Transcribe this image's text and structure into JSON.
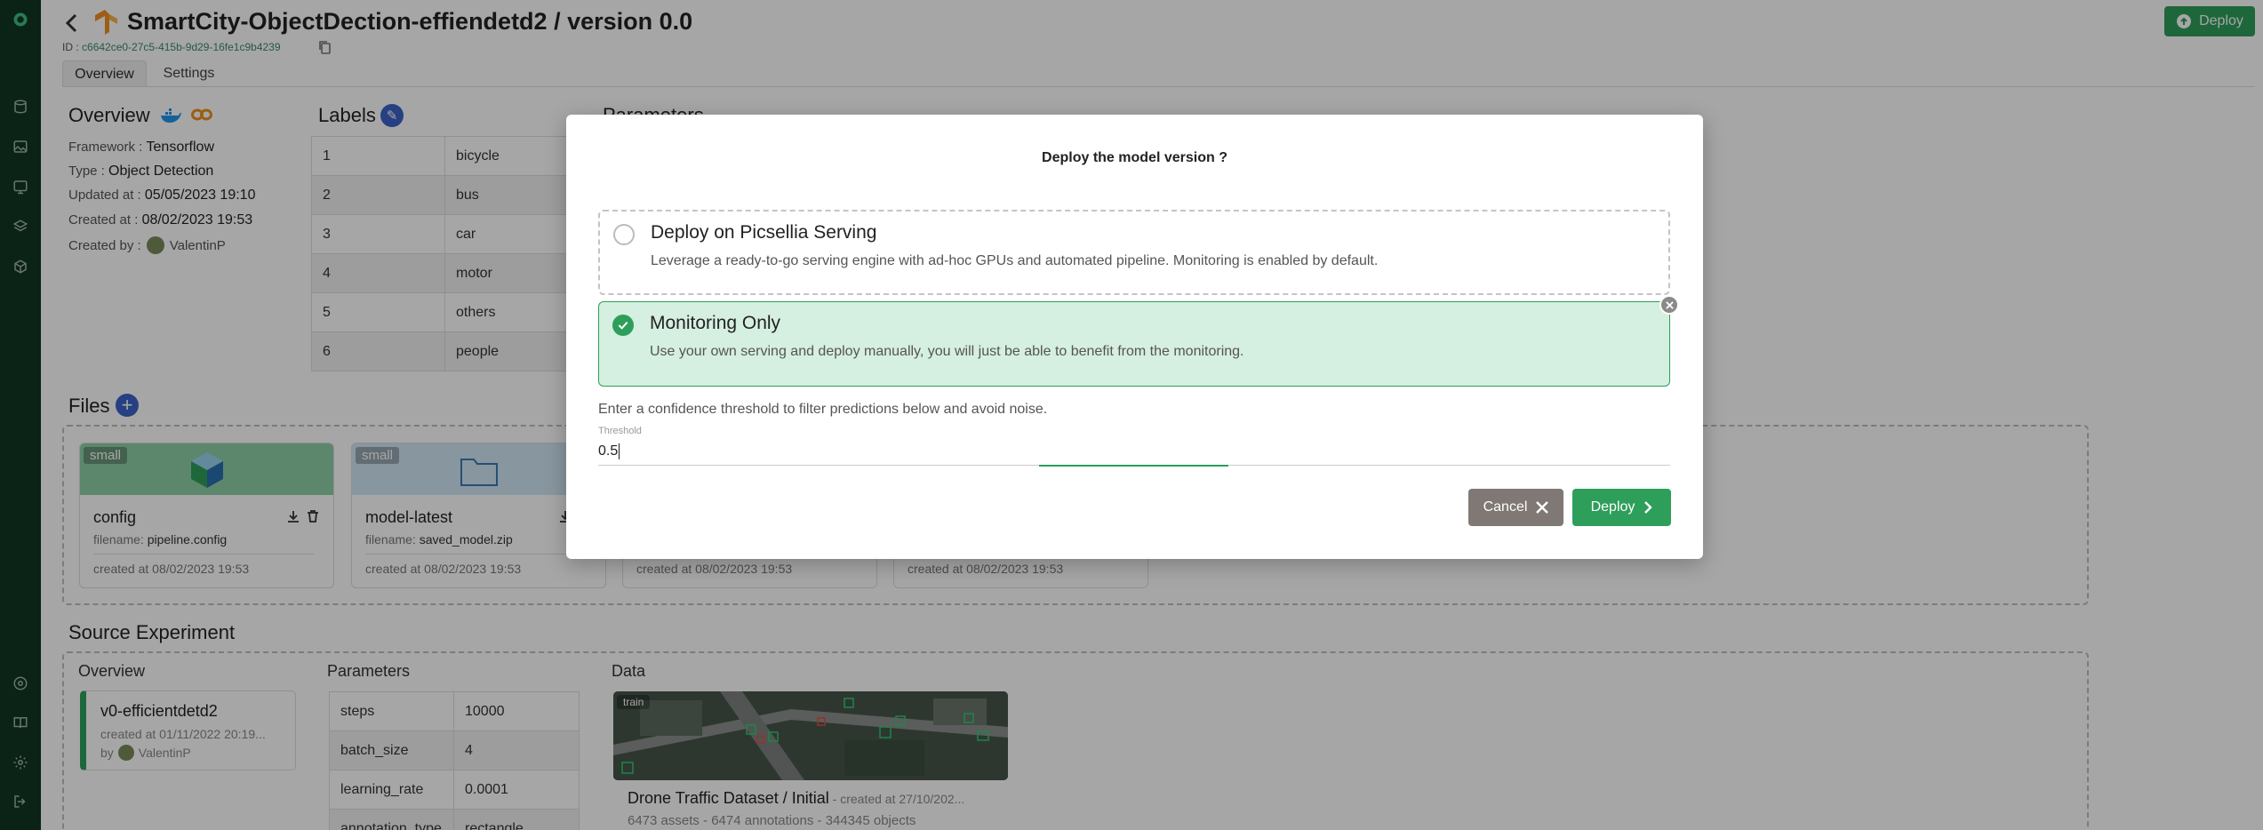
{
  "header": {
    "title": "SmartCity-ObjectDection-effiendetd2 / version 0.0",
    "id_label": "ID :",
    "id_value": "c6642ce0-27c5-415b-9d29-16fe1c9b4239",
    "deploy_label": "Deploy"
  },
  "tabs": [
    {
      "label": "Overview"
    },
    {
      "label": "Settings"
    }
  ],
  "overview": {
    "title": "Overview",
    "framework_label": "Framework :",
    "framework": "Tensorflow",
    "type_label": "Type :",
    "type": "Object Detection",
    "updated_label": "Updated at :",
    "updated": "05/05/2023 19:10",
    "created_label": "Created at :",
    "created": "08/02/2023 19:53",
    "creator_label": "Created by :",
    "creator": "ValentinP"
  },
  "labels": {
    "title": "Labels",
    "rows": [
      {
        "num": "1",
        "name": "bicycle"
      },
      {
        "num": "2",
        "name": "bus"
      },
      {
        "num": "3",
        "name": "car"
      },
      {
        "num": "4",
        "name": "motor"
      },
      {
        "num": "5",
        "name": "others"
      },
      {
        "num": "6",
        "name": "people"
      }
    ]
  },
  "parameters_partial_title": "Parameters",
  "files": {
    "title": "Files",
    "filename_label": "filename:",
    "cards": [
      {
        "tag": "small",
        "name": "config",
        "filename": "pipeline.config",
        "created": "created at 08/02/2023 19:53"
      },
      {
        "tag": "small",
        "name": "model-latest",
        "filename": "saved_model.zip",
        "created": "created at 08/02/2023 19:53"
      },
      {
        "created": "created at 08/02/2023 19:53"
      },
      {
        "created": "created at 08/02/2023 19:53"
      }
    ]
  },
  "source_experiment": {
    "title": "Source Experiment",
    "overview_title": "Overview",
    "experiment_name": "v0-efficientdetd2",
    "experiment_created": "created at 01/11/2022 20:19...",
    "by_label": "by",
    "experiment_creator": "ValentinP",
    "parameters_title": "Parameters",
    "parameters": [
      {
        "key": "steps",
        "value": "10000"
      },
      {
        "key": "batch_size",
        "value": "4"
      },
      {
        "key": "learning_rate",
        "value": "0.0001"
      },
      {
        "key": "annotation_type",
        "value": "rectangle"
      }
    ],
    "data_title": "Data",
    "dataset_tag": "train",
    "dataset_name": "Drone Traffic Dataset / Initial",
    "dataset_created": " - created at 27/10/202...",
    "dataset_stats": "6473 assets - 6474 annotations - 344345 objects"
  },
  "modal": {
    "title": "Deploy the model version ?",
    "option1": {
      "title": "Deploy on Picsellia Serving",
      "description": "Leverage a ready-to-go serving engine with ad-hoc GPUs and automated pipeline. Monitoring is enabled by default."
    },
    "option2": {
      "title": "Monitoring Only",
      "description": "Use your own serving and deploy manually, you will just be able to benefit from the monitoring."
    },
    "threshold_help": "Enter a confidence threshold to filter predictions below and avoid noise.",
    "threshold_label": "Threshold",
    "threshold_value": "0.5",
    "cancel_label": "Cancel",
    "deploy_label": "Deploy"
  },
  "colors": {
    "rail": "#123524",
    "accent_green": "#2e9e5b",
    "selected_bg": "#d5efe0",
    "cancel_grey": "#7f7874",
    "label_blue": "#3d63c8"
  }
}
